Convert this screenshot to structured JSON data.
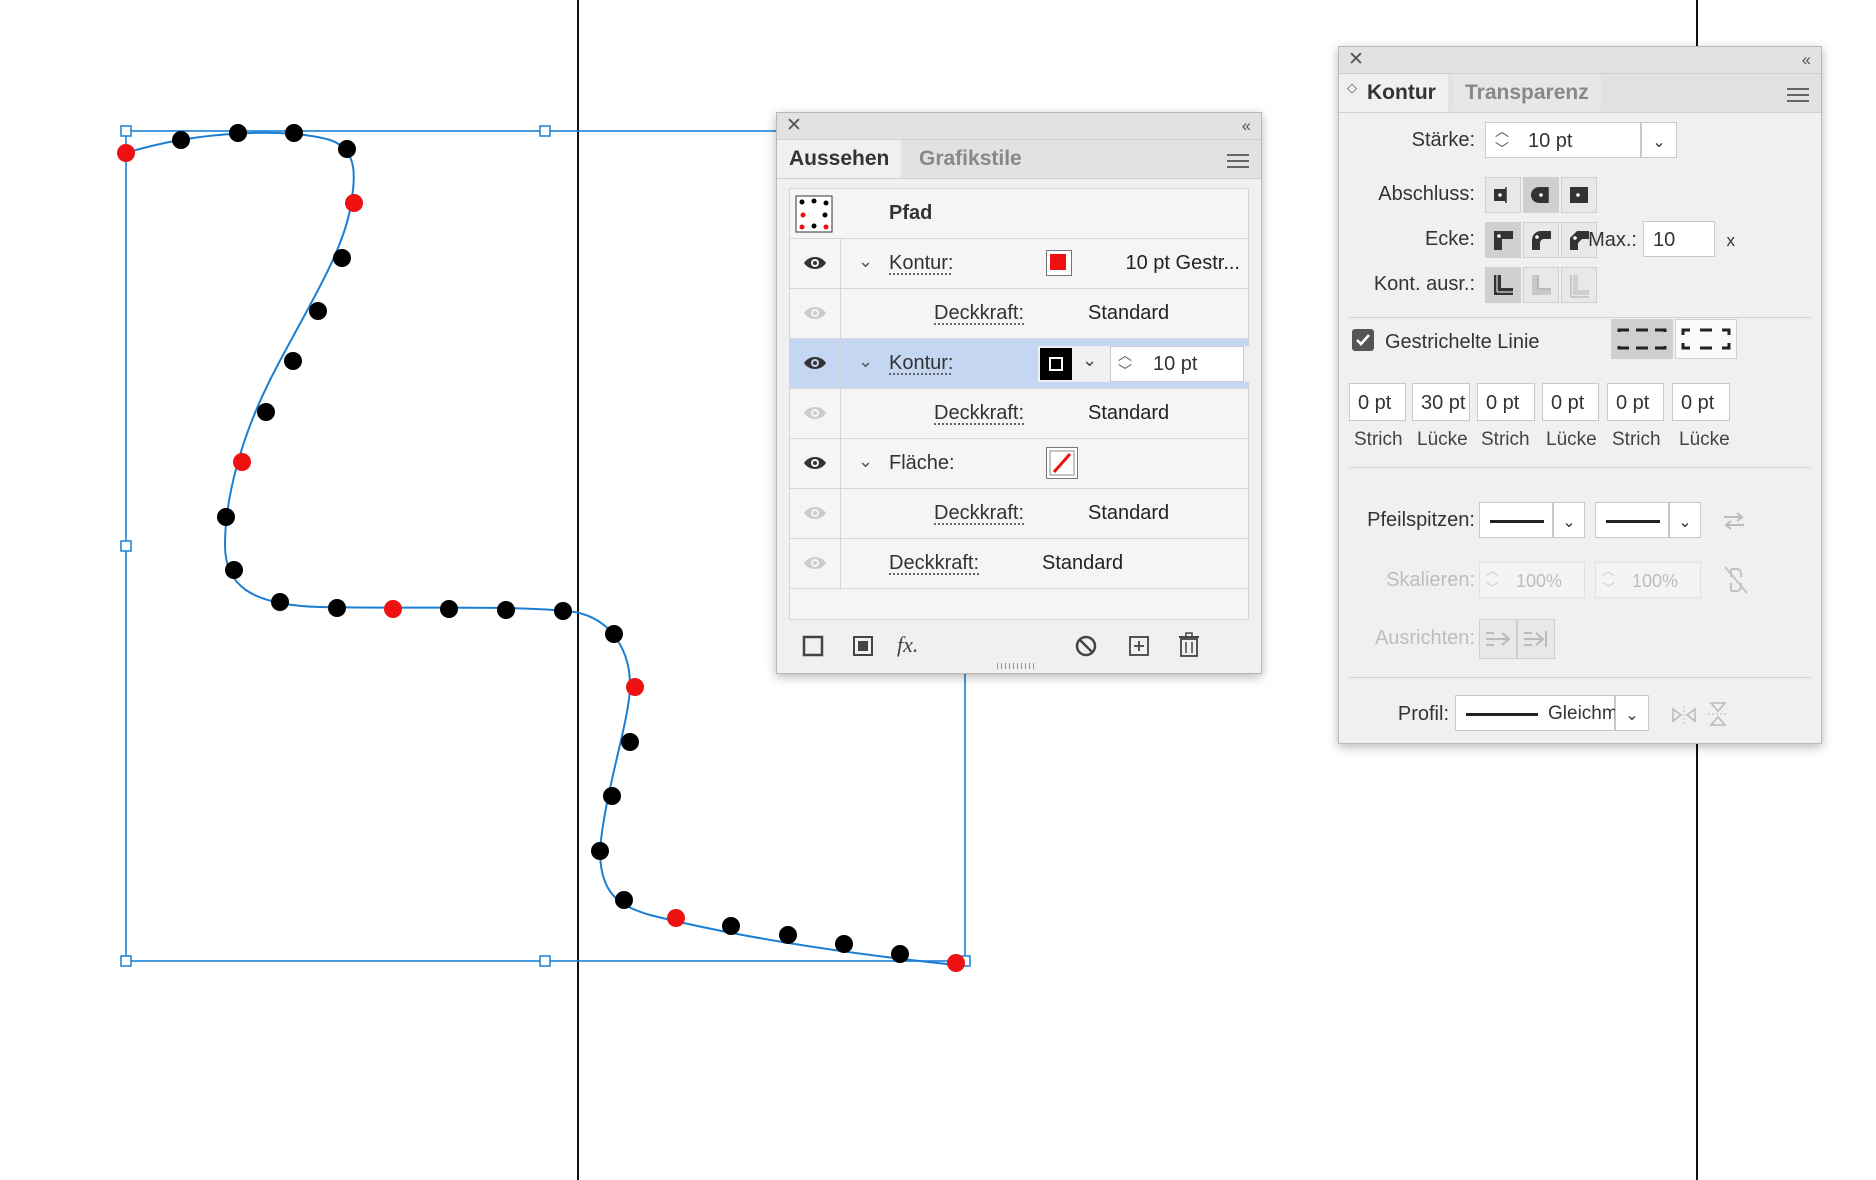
{
  "appearance_panel": {
    "tabs": [
      "Aussehen",
      "Grafikstile"
    ],
    "object_name": "Pfad",
    "rows": [
      {
        "kind": "stroke",
        "label": "Kontur:",
        "swatch": "#ee1111",
        "value": "10 pt Gestr..."
      },
      {
        "kind": "opacity",
        "label": "Deckkraft:",
        "value": "Standard"
      },
      {
        "kind": "stroke-selected",
        "label": "Kontur:",
        "swatch": "#000000",
        "weight": "10 pt"
      },
      {
        "kind": "opacity",
        "label": "Deckkraft:",
        "value": "Standard"
      },
      {
        "kind": "fill",
        "label": "Fläche:",
        "swatch": "none"
      },
      {
        "kind": "opacity",
        "label": "Deckkraft:",
        "value": "Standard"
      },
      {
        "kind": "object-opacity",
        "label": "Deckkraft:",
        "value": "Standard"
      }
    ],
    "footer_icons": [
      "add-stroke-icon",
      "add-fill-icon",
      "fx-icon",
      "clear-appearance-icon",
      "duplicate-item-icon",
      "trash-icon"
    ],
    "fx_label": "fx."
  },
  "stroke_panel": {
    "tabs": [
      "Kontur",
      "Transparenz"
    ],
    "weight_label": "Stärke:",
    "weight_value": "10 pt",
    "cap_label": "Abschluss:",
    "corner_label": "Ecke:",
    "miter_label": "Max.:",
    "miter_value": "10",
    "miter_suffix": "x",
    "align_label": "Kont. ausr.:",
    "dashed_checked": true,
    "dashed_label": "Gestrichelte Linie",
    "dash_values": [
      "0 pt",
      "30 pt",
      "0 pt",
      "0 pt",
      "0 pt",
      "0 pt"
    ],
    "dash_labels": [
      "Strich",
      "Lücke",
      "Strich",
      "Lücke",
      "Strich",
      "Lücke"
    ],
    "arrowheads_label": "Pfeilspitzen:",
    "scale_label": "Skalieren:",
    "scale_values": [
      "100%",
      "100%"
    ],
    "align_arrows_label": "Ausrichten:",
    "profile_label": "Profil:",
    "profile_value": "Gleichm."
  },
  "colors": {
    "path_blue": "#1a7fd4",
    "red_dot": "#ee1111",
    "selection_row": "#c4d6f2"
  }
}
